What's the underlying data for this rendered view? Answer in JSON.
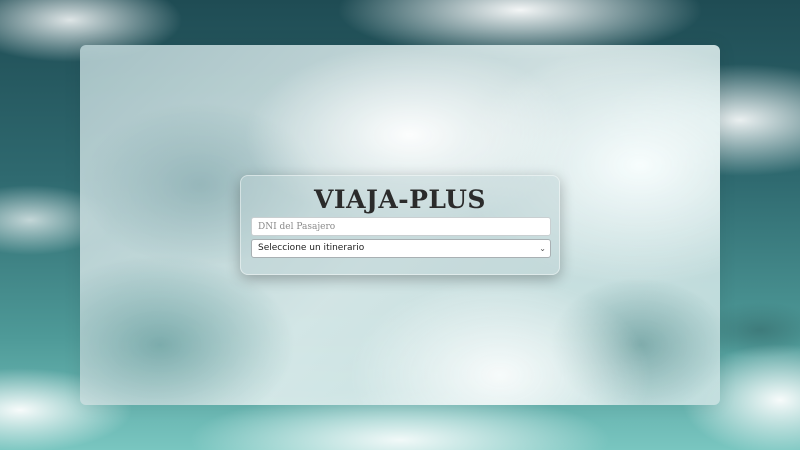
{
  "app": {
    "title": "VIAJA-PLUS"
  },
  "form": {
    "dni_placeholder": "DNI del Pasajero",
    "dni_value": "",
    "itinerary_selected": "Seleccione un itinerario"
  },
  "icons": {
    "select_chevron": "chevron-down-icon"
  },
  "colors": {
    "title": "#2b2b2b",
    "sky_dark": "#1f4c54",
    "sky_light": "#79c6c0"
  }
}
